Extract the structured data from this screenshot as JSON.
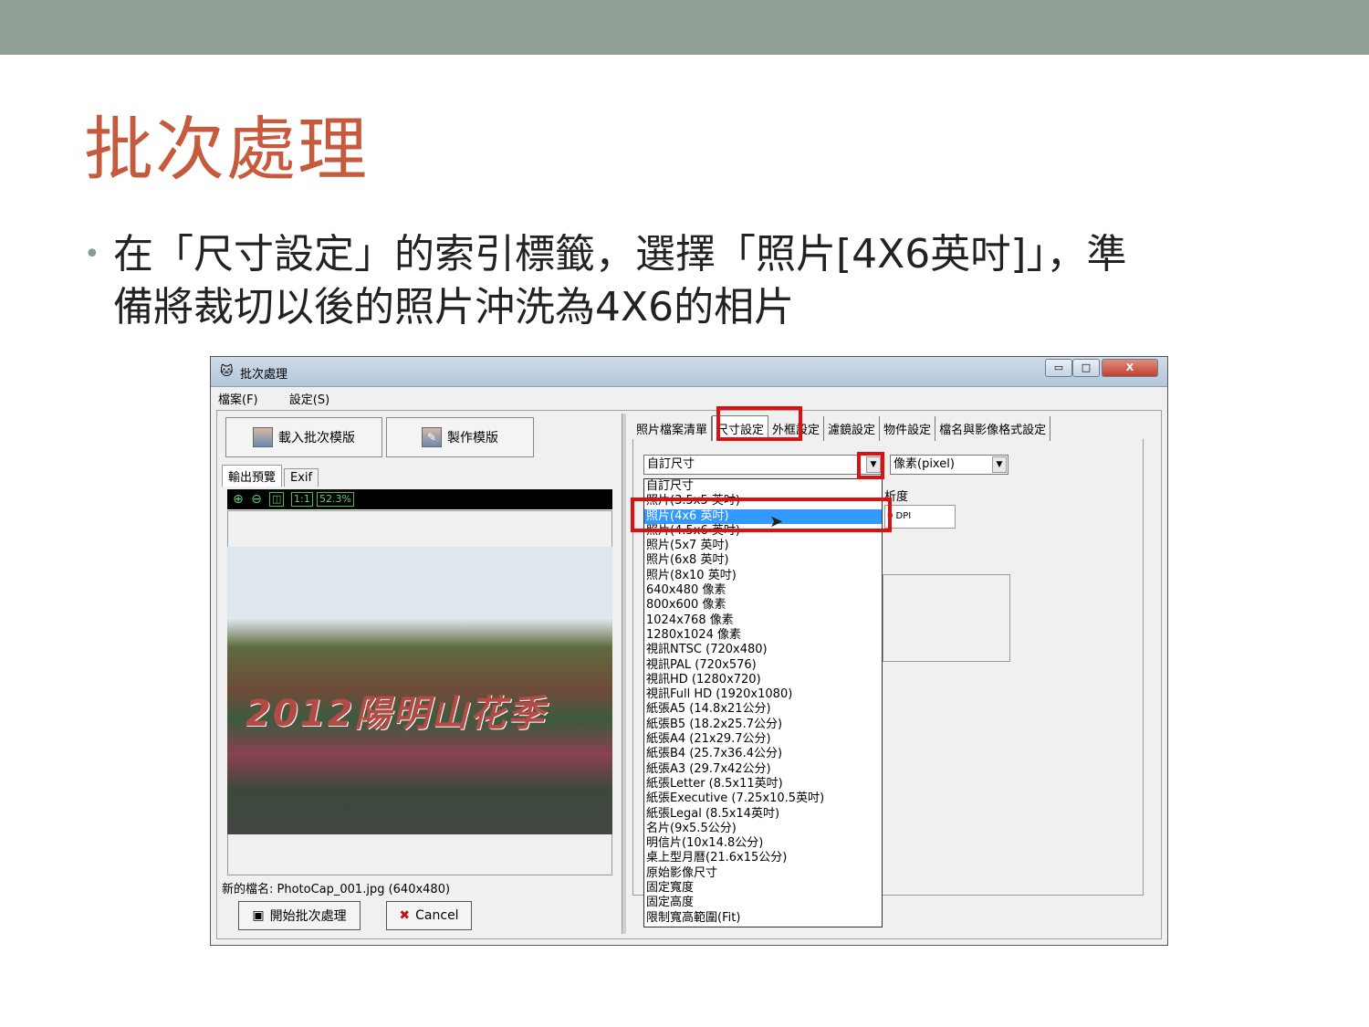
{
  "slide": {
    "title": "批次處理",
    "bullet_line1": "在「尺寸設定」的索引標籤，選擇「照片[4X6英吋]」，準",
    "bullet_line2": "備將裁切以後的照片沖洗為4X6的相片"
  },
  "window": {
    "title": "批次處理",
    "controls": {
      "minimize": "▭",
      "maximize": "□",
      "close": "X"
    },
    "menu": [
      "檔案(F)",
      "設定(S)"
    ],
    "toolbar": {
      "load_template": "載入批次模版",
      "make_template": "製作模版"
    },
    "left_tabs": [
      "輸出預覽",
      "Exif"
    ],
    "preview": {
      "zoom": "52.3%",
      "fit_label": "1:1",
      "photo_caption": "2012陽明山花季"
    },
    "status": "新的檔名: PhotoCap_001.jpg (640x480)",
    "buttons": {
      "start": "開始批次處理",
      "cancel": "Cancel"
    },
    "right_tabs": [
      "照片檔案清單",
      "尺寸設定",
      "外框設定",
      "濾鏡設定",
      "物件設定",
      "檔名與影像格式設定"
    ],
    "size_combo": "自訂尺寸",
    "unit_combo": "像素(pixel)",
    "resolution_label": "析度",
    "resolution_unit": "0 DPI",
    "size_options": [
      "自訂尺寸",
      "照片(3.5x5 英吋)",
      "照片(4x6 英吋)",
      "照片(4.5x6 英吋)",
      "照片(5x7 英吋)",
      "照片(6x8 英吋)",
      "照片(8x10 英吋)",
      "640x480 像素",
      "800x600 像素",
      "1024x768 像素",
      "1280x1024 像素",
      "視訊NTSC (720x480)",
      "視訊PAL (720x576)",
      "視訊HD (1280x720)",
      "視訊Full HD (1920x1080)",
      "紙張A5 (14.8x21公分)",
      "紙張B5 (18.2x25.7公分)",
      "紙張A4 (21x29.7公分)",
      "紙張B4 (25.7x36.4公分)",
      "紙張A3 (29.7x42公分)",
      "紙張Letter (8.5x11英吋)",
      "紙張Executive (7.25x10.5英吋)",
      "紙張Legal (8.5x14英吋)",
      "名片(9x5.5公分)",
      "明信片(10x14.8公分)",
      "桌上型月曆(21.6x15公分)",
      "原始影像尺寸",
      "固定寬度",
      "固定高度",
      "限制寬高範圍(Fit)"
    ],
    "selected_option_index": 2
  }
}
